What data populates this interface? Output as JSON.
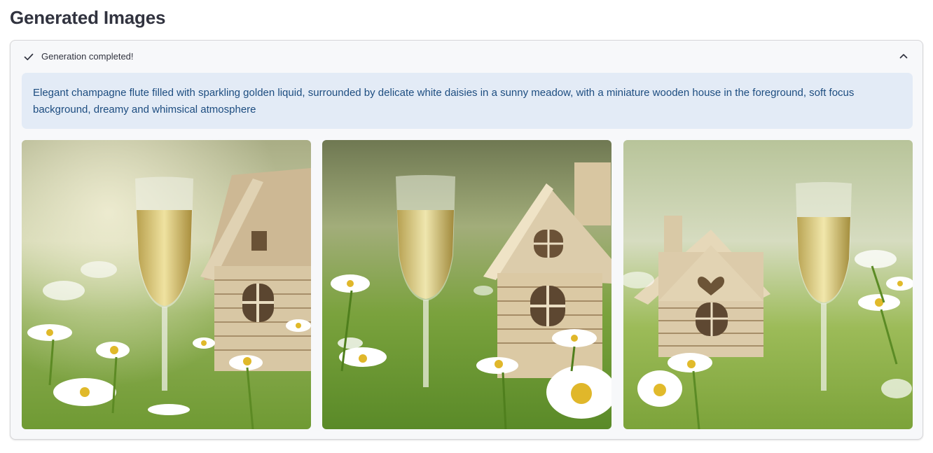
{
  "page_title": "Generated Images",
  "status": {
    "label": "Generation completed!",
    "icon": "check-icon",
    "collapse_icon": "chevron-up-icon"
  },
  "prompt": "Elegant champagne flute filled with sparkling golden liquid, surrounded by delicate white daisies in a sunny meadow, with a miniature wooden house in the foreground, soft focus background, dreamy and whimsical atmosphere",
  "images": [
    {
      "name": "generated-image-1",
      "description": "champagne flute left, wooden house right"
    },
    {
      "name": "generated-image-2",
      "description": "champagne flute left, wooden house with chimney right"
    },
    {
      "name": "generated-image-3",
      "description": "wooden house with heart window left, champagne flute right"
    }
  ],
  "colors": {
    "prompt_background": "#e3ebf6",
    "prompt_text": "#1d4d80",
    "panel_background": "#f7f8fa"
  }
}
